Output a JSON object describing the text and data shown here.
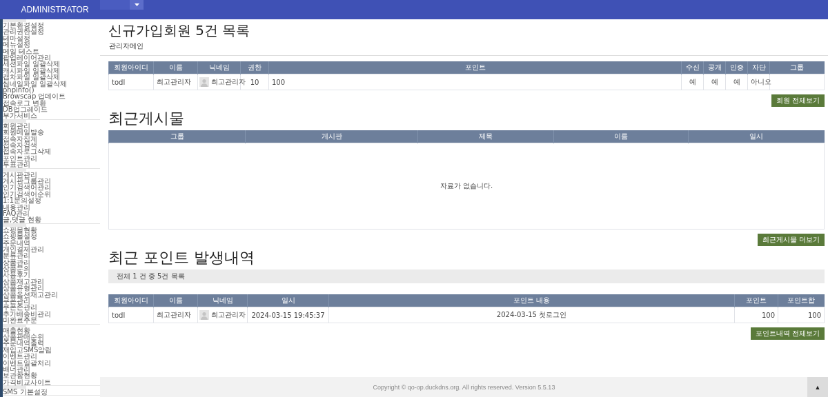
{
  "header": {
    "title": "ADMINISTRATOR"
  },
  "sidebar": {
    "groups": [
      {
        "items": [
          "기본환경설정",
          "관리권한설정",
          "테마설정",
          "메뉴설정",
          "메일 테스트",
          "팝업레이어관리",
          "세션파일 일괄삭제",
          "캐시파일 일괄삭제",
          "캡차파일 일괄삭제",
          "썸네일파일 일괄삭제",
          "phpinfo()",
          "Browscap 업데이트",
          "접속로그 변환",
          "DB업그레이드",
          "부가서비스"
        ]
      },
      {
        "items": [
          "회원관리",
          "회원메일발송",
          "접속자집계",
          "접속자검색",
          "접속자로그삭제",
          "포인트관리",
          "투표관리"
        ]
      },
      {
        "items": [
          "게시판관리",
          "게시판그룹관리",
          "인기검색어관리",
          "인기검색어순위",
          "1:1문의설정",
          "내용관리",
          "FAQ관리",
          "글,댓글 현황"
        ]
      },
      {
        "items": [
          "쇼핑몰현황",
          "쇼핑몰설정",
          "주문내역",
          "개인결제관리",
          "분류관리",
          "상품관리",
          "상품문의",
          "사용후기",
          "상품재고관리",
          "상품유형관리",
          "상품옵션재고관리",
          "쿠폰관리",
          "쿠폰존관리",
          "추가배송비관리",
          "미완료주문"
        ]
      },
      {
        "items": [
          "매출현황",
          "상품판매순위",
          "주문내역출력",
          "재입고SMS알림",
          "이벤트관리",
          "이벤트일괄처리",
          "배너관리",
          "보관함현황",
          "가격비교사이트"
        ]
      },
      {
        "items": [
          "SMS 기본설정"
        ]
      }
    ]
  },
  "page": {
    "title": "신규가입회원 5건 목록",
    "breadcrumb": "관리자메인"
  },
  "sections": [
    {
      "kind": "members",
      "columns": [
        "회원아이디",
        "이름",
        "닉네임",
        "권한",
        "포인트",
        "수신",
        "공개",
        "인증",
        "차단",
        "그룹"
      ],
      "rows": [
        {
          "cells": [
            {
              "kind": "left",
              "text": "todl"
            },
            {
              "kind": "left",
              "text": "최고관리자"
            },
            {
              "kind": "avatar",
              "text": "최고관리자"
            },
            {
              "kind": "center",
              "text": "10"
            },
            {
              "kind": "left",
              "text": "100"
            },
            {
              "kind": "center",
              "text": "예"
            },
            {
              "kind": "center",
              "text": "예"
            },
            {
              "kind": "center",
              "text": "예"
            },
            {
              "kind": "center",
              "text": "아니오"
            }
          ]
        }
      ],
      "button": "회원 전체보기"
    },
    {
      "kind": "posts",
      "title": "최근게시물",
      "columns": [
        "그룹",
        "게시판",
        "제목",
        "이름",
        "일시"
      ],
      "empty": "자료가 없습니다.",
      "button": "최근게시물 더보기"
    },
    {
      "kind": "points",
      "title": "최근 포인트 발생내역",
      "summary": "전체 1 건 중 5건 목록",
      "columns": [
        "회원아이디",
        "이름",
        "닉네임",
        "일시",
        "포인트 내용",
        "포인트",
        "포인트합"
      ],
      "rows": [
        {
          "cells": [
            {
              "kind": "left",
              "text": "todl"
            },
            {
              "kind": "left",
              "text": "최고관리자"
            },
            {
              "kind": "avatar",
              "text": "최고관리자"
            },
            {
              "kind": "center",
              "text": "2024-03-15 19:45:37"
            },
            {
              "kind": "center",
              "text": "2024-03-15 첫로그인"
            },
            {
              "kind": "right",
              "text": "100"
            },
            {
              "kind": "right",
              "text": "100"
            }
          ]
        }
      ],
      "button": "포인트내역 전체보기"
    }
  ],
  "footer": {
    "copyright": "Copyright © qo-op.duckdns.org. All rights reserved. Version 5.5.13",
    "top_button": "▲"
  }
}
